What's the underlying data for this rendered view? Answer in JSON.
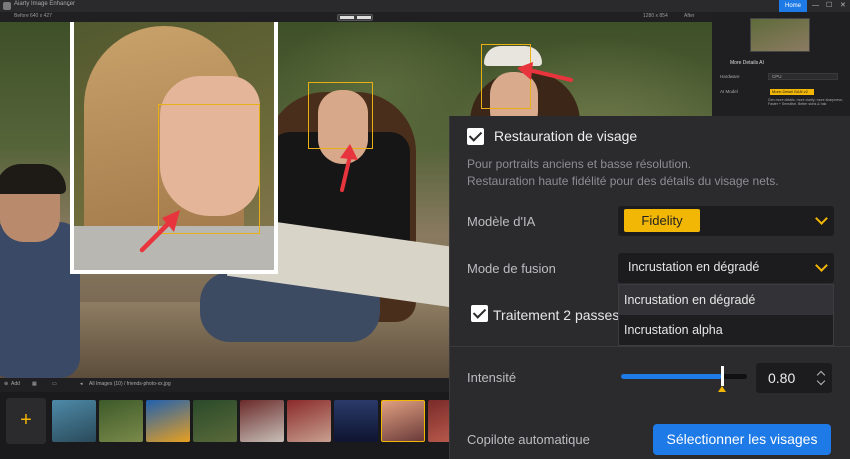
{
  "titlebar": {
    "app_title": "Aiarty Image Enhancer",
    "caret": "⌄",
    "home_label": "Home",
    "minimize": "—",
    "maximize": "☐",
    "close": "✕"
  },
  "preview_header": {
    "before_label": "Before",
    "before_size": "640 x 427",
    "after_size": "1280 x 854",
    "after_label": "After"
  },
  "right_panel": {
    "section_title": "More Details AI",
    "hardware_label": "Hardware",
    "hardware_value": "CPU",
    "model_label": "AI Model",
    "model_value": "More-Detail GAN  v2",
    "model_desc": "Gen more details, more clarity; more sharpness; Faster + Sensitive. Better skins & hair."
  },
  "bottombar": {
    "add_label": "Add",
    "breadcrumb": "All Images (10)  /   friends-photo-xx.jpg"
  },
  "overlay": {
    "face_restore_label": "Restauration de visage",
    "description_line1": "Pour portraits anciens et basse résolution.",
    "description_line2": "Restauration haute fidélité pour des détails du visage nets.",
    "ai_model_label": "Modèle d'IA",
    "ai_model_value": "Fidelity",
    "blend_mode_label": "Mode de fusion",
    "blend_mode_value": "Incrustation en dégradé",
    "blend_options": [
      "Incrustation en dégradé",
      "Incrustation alpha"
    ],
    "two_pass_label": "Traitement 2 passes",
    "intensity_label": "Intensité",
    "intensity_value": "0.80",
    "intensity_fraction": 0.8,
    "autopilot_label": "Copilote automatique",
    "select_faces_label": "Sélectionner les visages"
  },
  "colors": {
    "accent_yellow": "#f2b705",
    "accent_blue": "#1e7ae6",
    "panel_bg": "#2b2b2e"
  }
}
